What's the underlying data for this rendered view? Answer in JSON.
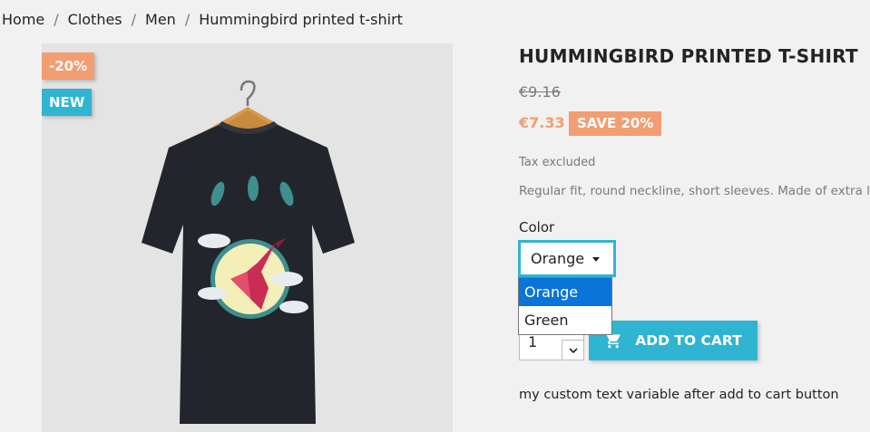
{
  "breadcrumb": {
    "items": [
      "Home",
      "Clothes",
      "Men",
      "Hummingbird printed t-shirt"
    ],
    "separator": "/"
  },
  "image": {
    "flags": {
      "discount": "-20%",
      "new": "NEW"
    },
    "icon": "tshirt-product-photo"
  },
  "product": {
    "title": "HUMMINGBIRD PRINTED T-SHIRT",
    "regular_price": "€9.16",
    "price": "€7.33",
    "discount_badge": "SAVE 20%",
    "tax_note": "Tax excluded",
    "description": "Regular fit, round neckline, short sleeves. Made of extra long s"
  },
  "variants": {
    "color_label": "Color",
    "selected": "Orange",
    "options": [
      "Orange",
      "Green"
    ]
  },
  "cart": {
    "quantity": "1",
    "add_label": "ADD TO CART",
    "cart_icon": "shopping-cart-icon"
  },
  "custom_text": "my custom text variable after add to cart button",
  "colors": {
    "accent": "#2fb5d2",
    "discount": "#f39d72",
    "selected_option": "#0a74d8"
  }
}
